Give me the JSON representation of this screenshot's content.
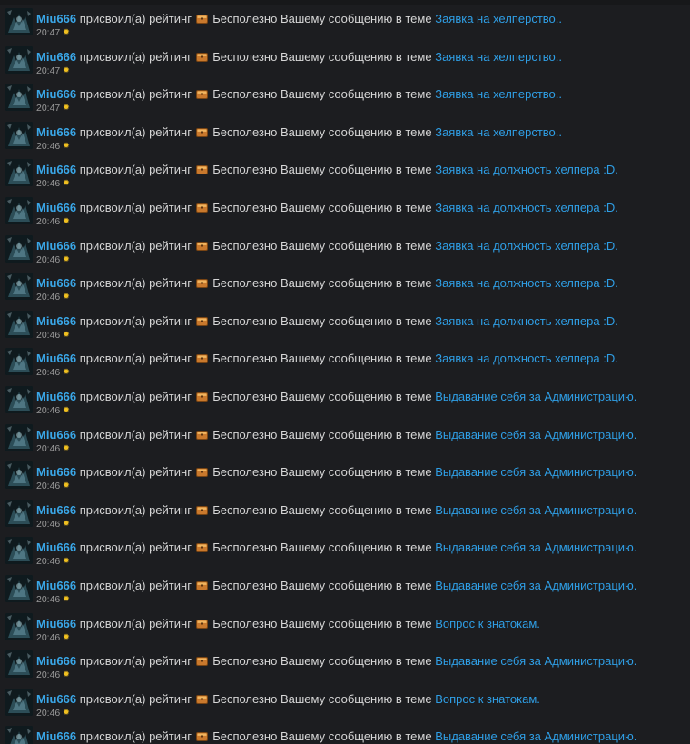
{
  "feed": {
    "items": [
      {
        "user": "Miu666",
        "action": "присвоил(а) рейтинг",
        "rating": "Бесполезно",
        "text": "Вашему сообщению в теме",
        "topic": "Заявка на хелперство..",
        "time": "20:47"
      },
      {
        "user": "Miu666",
        "action": "присвоил(а) рейтинг",
        "rating": "Бесполезно",
        "text": "Вашему сообщению в теме",
        "topic": "Заявка на хелперство..",
        "time": "20:47"
      },
      {
        "user": "Miu666",
        "action": "присвоил(а) рейтинг",
        "rating": "Бесполезно",
        "text": "Вашему сообщению в теме",
        "topic": "Заявка на хелперство..",
        "time": "20:47"
      },
      {
        "user": "Miu666",
        "action": "присвоил(а) рейтинг",
        "rating": "Бесполезно",
        "text": "Вашему сообщению в теме",
        "topic": "Заявка на хелперство..",
        "time": "20:46"
      },
      {
        "user": "Miu666",
        "action": "присвоил(а) рейтинг",
        "rating": "Бесполезно",
        "text": "Вашему сообщению в теме",
        "topic": "Заявка на должность хелпера :D.",
        "time": "20:46"
      },
      {
        "user": "Miu666",
        "action": "присвоил(а) рейтинг",
        "rating": "Бесполезно",
        "text": "Вашему сообщению в теме",
        "topic": "Заявка на должность хелпера :D.",
        "time": "20:46"
      },
      {
        "user": "Miu666",
        "action": "присвоил(а) рейтинг",
        "rating": "Бесполезно",
        "text": "Вашему сообщению в теме",
        "topic": "Заявка на должность хелпера :D.",
        "time": "20:46"
      },
      {
        "user": "Miu666",
        "action": "присвоил(а) рейтинг",
        "rating": "Бесполезно",
        "text": "Вашему сообщению в теме",
        "topic": "Заявка на должность хелпера :D.",
        "time": "20:46"
      },
      {
        "user": "Miu666",
        "action": "присвоил(а) рейтинг",
        "rating": "Бесполезно",
        "text": "Вашему сообщению в теме",
        "topic": "Заявка на должность хелпера :D.",
        "time": "20:46"
      },
      {
        "user": "Miu666",
        "action": "присвоил(а) рейтинг",
        "rating": "Бесполезно",
        "text": "Вашему сообщению в теме",
        "topic": "Заявка на должность хелпера :D.",
        "time": "20:46"
      },
      {
        "user": "Miu666",
        "action": "присвоил(а) рейтинг",
        "rating": "Бесполезно",
        "text": "Вашему сообщению в теме",
        "topic": "Выдавание себя за Администрацию.",
        "time": "20:46"
      },
      {
        "user": "Miu666",
        "action": "присвоил(а) рейтинг",
        "rating": "Бесполезно",
        "text": "Вашему сообщению в теме",
        "topic": "Выдавание себя за Администрацию.",
        "time": "20:46"
      },
      {
        "user": "Miu666",
        "action": "присвоил(а) рейтинг",
        "rating": "Бесполезно",
        "text": "Вашему сообщению в теме",
        "topic": "Выдавание себя за Администрацию.",
        "time": "20:46"
      },
      {
        "user": "Miu666",
        "action": "присвоил(а) рейтинг",
        "rating": "Бесполезно",
        "text": "Вашему сообщению в теме",
        "topic": "Выдавание себя за Администрацию.",
        "time": "20:46"
      },
      {
        "user": "Miu666",
        "action": "присвоил(а) рейтинг",
        "rating": "Бесполезно",
        "text": "Вашему сообщению в теме",
        "topic": "Выдавание себя за Администрацию.",
        "time": "20:46"
      },
      {
        "user": "Miu666",
        "action": "присвоил(а) рейтинг",
        "rating": "Бесполезно",
        "text": "Вашему сообщению в теме",
        "topic": "Выдавание себя за Администрацию.",
        "time": "20:46"
      },
      {
        "user": "Miu666",
        "action": "присвоил(а) рейтинг",
        "rating": "Бесполезно",
        "text": "Вашему сообщению в теме",
        "topic": "Вопрос к знатокам.",
        "time": "20:46"
      },
      {
        "user": "Miu666",
        "action": "присвоил(а) рейтинг",
        "rating": "Бесполезно",
        "text": "Вашему сообщению в теме",
        "topic": "Выдавание себя за Администрацию.",
        "time": "20:46"
      },
      {
        "user": "Miu666",
        "action": "присвоил(а) рейтинг",
        "rating": "Бесполезно",
        "text": "Вашему сообщению в теме",
        "topic": "Вопрос к знатокам.",
        "time": "20:46"
      },
      {
        "user": "Miu666",
        "action": "присвоил(а) рейтинг",
        "rating": "Бесполезно",
        "text": "Вашему сообщению в теме",
        "topic": "Выдавание себя за Администрацию.",
        "time": ""
      }
    ],
    "rating_icon": "box-icon",
    "star_icon": "star-icon",
    "colors": {
      "background": "#1c1d20",
      "username": "#3aa7e8",
      "topic_link": "#2f9fe6",
      "text": "#d6d6d6",
      "time": "#9a9a9a",
      "star": "#f0c020"
    }
  }
}
